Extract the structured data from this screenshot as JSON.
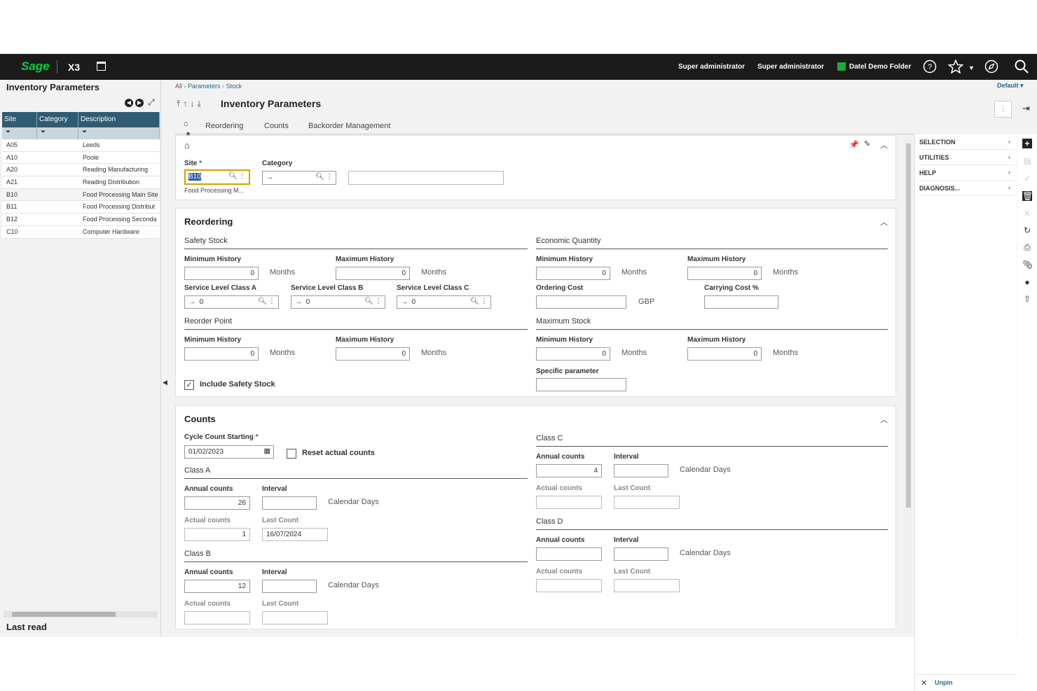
{
  "topbar": {
    "logo": "Sage",
    "product": "X3",
    "user1": "Super administrator",
    "user2": "Super administrator",
    "folder": "Datel Demo Folder",
    "default_label": "Default"
  },
  "left": {
    "title": "Inventory Parameters",
    "columns": [
      "Site",
      "Category",
      "Description"
    ],
    "rows": [
      {
        "site": "A05",
        "category": "",
        "description": "Leeds"
      },
      {
        "site": "A10",
        "category": "",
        "description": "Poole"
      },
      {
        "site": "A20",
        "category": "",
        "description": "Reading Manufacturing"
      },
      {
        "site": "A21",
        "category": "",
        "description": "Reading Distribution"
      },
      {
        "site": "B10",
        "category": "",
        "description": "Food Processing Main Site"
      },
      {
        "site": "B11",
        "category": "",
        "description": "Food Processing Distribut"
      },
      {
        "site": "B12",
        "category": "",
        "description": "Food Processing Seconda"
      },
      {
        "site": "C10",
        "category": "",
        "description": "Computer Hardware"
      }
    ],
    "last_read": "Last read"
  },
  "breadcrumb": {
    "all": "All",
    "parameters": "Parameters",
    "stock": "Stock"
  },
  "page_title": "Inventory Parameters",
  "tabs": [
    "Reordering",
    "Counts",
    "Backorder Management"
  ],
  "header": {
    "site_label": "Site",
    "site_value": "B10",
    "site_desc": "Food Processing M...",
    "category_label": "Category"
  },
  "reordering": {
    "title": "Reordering",
    "safety_stock": "Safety Stock",
    "economic_quantity": "Economic Quantity",
    "reorder_point": "Reorder Point",
    "maximum_stock": "Maximum Stock",
    "min_history": "Minimum History",
    "max_history": "Maximum History",
    "months": "Months",
    "zero": "0",
    "service_a": "Service Level Class A",
    "service_b": "Service Level Class B",
    "service_c": "Service Level Class C",
    "ordering_cost": "Ordering Cost",
    "currency": "GBP",
    "carrying_cost": "Carrying Cost %",
    "specific_parameter": "Specific parameter",
    "include_safety": "Include Safety Stock"
  },
  "counts": {
    "title": "Counts",
    "cycle_label": "Cycle Count Starting",
    "cycle_value": "01/02/2023",
    "reset_label": "Reset actual counts",
    "annual": "Annual counts",
    "interval": "Interval",
    "calendar_days": "Calendar Days",
    "actual": "Actual counts",
    "last_count": "Last Count",
    "class_a": {
      "title": "Class A",
      "annual": "26",
      "actual": "1",
      "last": "16/07/2024"
    },
    "class_b": {
      "title": "Class B",
      "annual": "12"
    },
    "class_c": {
      "title": "Class C",
      "annual": "4"
    },
    "class_d": {
      "title": "Class D"
    }
  },
  "right_panel": {
    "items": [
      "SELECTION",
      "UTILITIES",
      "HELP",
      "DIAGNOSIS..."
    ],
    "unpin": "Unpin"
  }
}
